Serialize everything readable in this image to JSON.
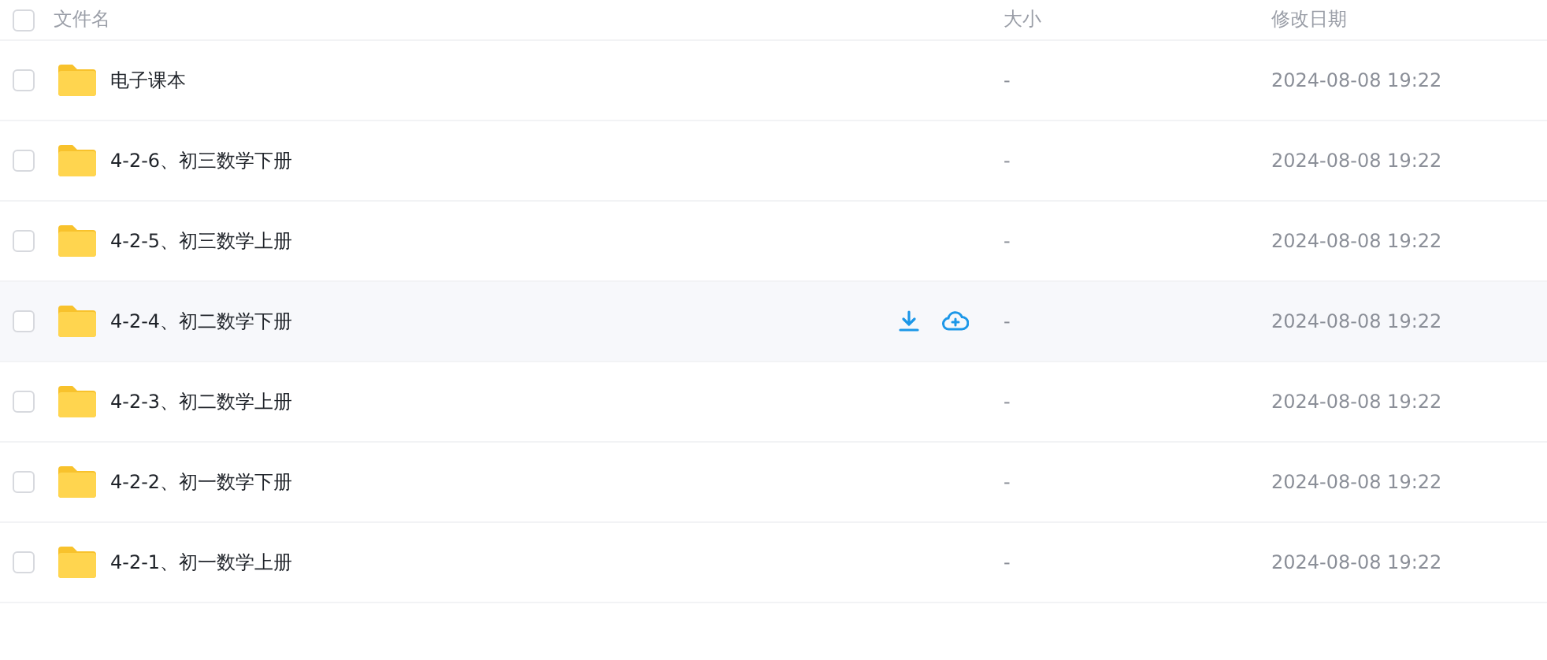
{
  "header": {
    "checked": false,
    "columns": [
      "文件名",
      "大小",
      "修改日期"
    ]
  },
  "rows": [
    {
      "name": "电子课本",
      "size": "-",
      "modified": "2024-08-08 19:22",
      "checked": false,
      "hovered": false
    },
    {
      "name": "4-2-6、初三数学下册",
      "size": "-",
      "modified": "2024-08-08 19:22",
      "checked": false,
      "hovered": false
    },
    {
      "name": "4-2-5、初三数学上册",
      "size": "-",
      "modified": "2024-08-08 19:22",
      "checked": false,
      "hovered": false
    },
    {
      "name": "4-2-4、初二数学下册",
      "size": "-",
      "modified": "2024-08-08 19:22",
      "checked": false,
      "hovered": true
    },
    {
      "name": "4-2-3、初二数学上册",
      "size": "-",
      "modified": "2024-08-08 19:22",
      "checked": false,
      "hovered": false
    },
    {
      "name": "4-2-2、初一数学下册",
      "size": "-",
      "modified": "2024-08-08 19:22",
      "checked": false,
      "hovered": false
    },
    {
      "name": "4-2-1、初一数学上册",
      "size": "-",
      "modified": "2024-08-08 19:22",
      "checked": false,
      "hovered": false
    }
  ]
}
